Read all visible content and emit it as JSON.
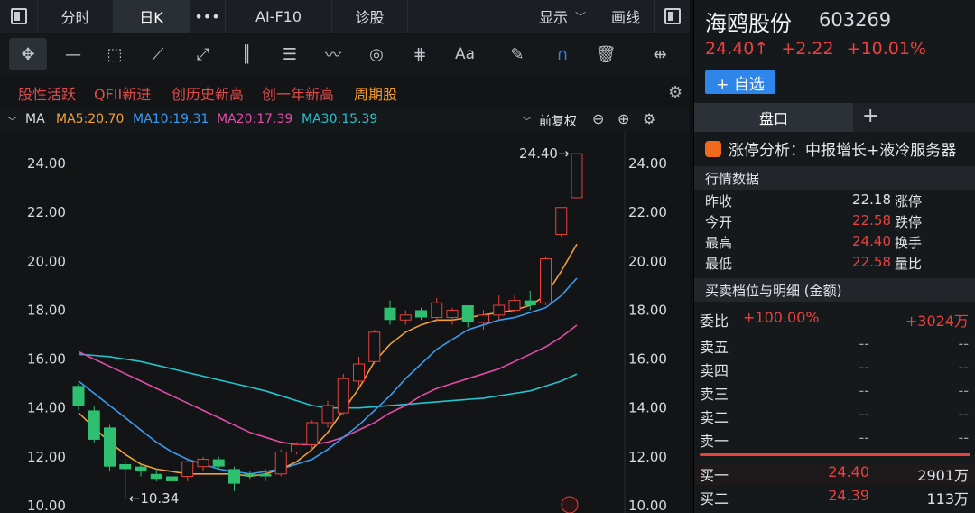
{
  "topbar": {
    "tabs": [
      "分时",
      "日K",
      "•••",
      "AI-F10",
      "诊股",
      "显示",
      "画线"
    ]
  },
  "tags": [
    "股性活跃",
    "QFII新进",
    "创历史新高",
    "创一年新高",
    "周期股"
  ],
  "ma_row": {
    "label": "MA",
    "ma5": "MA5:20.70",
    "ma10": "MA10:19.31",
    "ma20": "MA20:17.39",
    "ma30": "MA30:15.39",
    "adj": "前复权"
  },
  "stock": {
    "name": "海鸥股份",
    "code": "603269",
    "price": "24.40↑",
    "change": "+2.22",
    "pct": "+10.01%",
    "add_label": "+ 自选",
    "panel_tab": "盘口",
    "analysis": "涨停分析：中报增长+液冷服务器"
  },
  "quote": {
    "section_title": "行情数据",
    "rows": [
      {
        "label": "昨收",
        "value": "22.18",
        "label2": "涨停"
      },
      {
        "label": "今开",
        "value": "22.58",
        "label2": "跌停"
      },
      {
        "label": "最高",
        "value": "24.40",
        "label2": "换手"
      },
      {
        "label": "最低",
        "value": "22.58",
        "label2": "量比"
      }
    ]
  },
  "orderbook": {
    "section_title": "买卖档位与明细 (金额)",
    "ratio_label": "委比",
    "ratio_value": "+100.00%",
    "ratio_amount": "+3024万",
    "asks": [
      {
        "name": "卖五",
        "price": "--",
        "vol": "--"
      },
      {
        "name": "卖四",
        "price": "--",
        "vol": "--"
      },
      {
        "name": "卖三",
        "price": "--",
        "vol": "--"
      },
      {
        "name": "卖二",
        "price": "--",
        "vol": "--"
      },
      {
        "name": "卖一",
        "price": "--",
        "vol": "--"
      }
    ],
    "bids": [
      {
        "name": "买一",
        "price": "24.40",
        "vol": "2901万"
      },
      {
        "name": "买二",
        "price": "24.39",
        "vol": "113万"
      }
    ]
  },
  "chart_data": {
    "type": "candlestick",
    "y_ticks": [
      "24.00",
      "22.00",
      "20.00",
      "18.00",
      "16.00",
      "14.00",
      "12.00",
      "10.00"
    ],
    "ylim": [
      10,
      24.8
    ],
    "high_label": "24.40→",
    "low_label": "←10.34",
    "candles": [
      {
        "o": 14.9,
        "h": 15.0,
        "l": 13.9,
        "c": 14.1
      },
      {
        "o": 13.9,
        "h": 14.1,
        "l": 12.6,
        "c": 12.7
      },
      {
        "o": 13.2,
        "h": 13.3,
        "l": 11.4,
        "c": 11.6
      },
      {
        "o": 11.7,
        "h": 11.9,
        "l": 10.34,
        "c": 11.5
      },
      {
        "o": 11.6,
        "h": 11.7,
        "l": 11.2,
        "c": 11.4
      },
      {
        "o": 11.3,
        "h": 11.5,
        "l": 11.0,
        "c": 11.1
      },
      {
        "o": 11.2,
        "h": 11.4,
        "l": 10.9,
        "c": 11.0
      },
      {
        "o": 11.2,
        "h": 11.9,
        "l": 11.0,
        "c": 11.8
      },
      {
        "o": 11.6,
        "h": 12.0,
        "l": 11.4,
        "c": 11.9
      },
      {
        "o": 11.9,
        "h": 12.0,
        "l": 11.5,
        "c": 11.6
      },
      {
        "o": 11.5,
        "h": 11.6,
        "l": 10.6,
        "c": 10.9
      },
      {
        "o": 11.3,
        "h": 11.4,
        "l": 11.1,
        "c": 11.2
      },
      {
        "o": 11.3,
        "h": 11.5,
        "l": 11.0,
        "c": 11.2
      },
      {
        "o": 11.3,
        "h": 12.3,
        "l": 11.2,
        "c": 12.2
      },
      {
        "o": 12.2,
        "h": 12.6,
        "l": 12.1,
        "c": 12.5
      },
      {
        "o": 12.5,
        "h": 13.5,
        "l": 12.3,
        "c": 13.4
      },
      {
        "o": 13.4,
        "h": 14.3,
        "l": 13.2,
        "c": 14.1
      },
      {
        "o": 13.8,
        "h": 15.4,
        "l": 13.7,
        "c": 15.2
      },
      {
        "o": 15.1,
        "h": 16.1,
        "l": 14.9,
        "c": 15.8
      },
      {
        "o": 15.9,
        "h": 17.2,
        "l": 15.8,
        "c": 17.1
      },
      {
        "o": 18.1,
        "h": 18.4,
        "l": 17.4,
        "c": 17.6
      },
      {
        "o": 17.6,
        "h": 18.0,
        "l": 17.4,
        "c": 17.8
      },
      {
        "o": 18.0,
        "h": 18.1,
        "l": 17.6,
        "c": 17.7
      },
      {
        "o": 17.7,
        "h": 18.5,
        "l": 17.5,
        "c": 18.3
      },
      {
        "o": 17.7,
        "h": 18.1,
        "l": 17.4,
        "c": 18.0
      },
      {
        "o": 18.2,
        "h": 18.2,
        "l": 17.3,
        "c": 17.5
      },
      {
        "o": 17.5,
        "h": 18.0,
        "l": 17.2,
        "c": 17.8
      },
      {
        "o": 17.8,
        "h": 18.6,
        "l": 17.6,
        "c": 18.2
      },
      {
        "o": 18.0,
        "h": 18.6,
        "l": 17.9,
        "c": 18.4
      },
      {
        "o": 18.4,
        "h": 18.8,
        "l": 18.0,
        "c": 18.2
      },
      {
        "o": 18.3,
        "h": 20.2,
        "l": 18.2,
        "c": 20.1
      },
      {
        "o": 21.1,
        "h": 22.2,
        "l": 21.0,
        "c": 22.2
      },
      {
        "o": 22.6,
        "h": 24.4,
        "l": 22.58,
        "c": 24.4
      }
    ],
    "ma5": [
      13.8,
      13.2,
      12.6,
      12.1,
      11.7,
      11.5,
      11.4,
      11.3,
      11.3,
      11.3,
      11.3,
      11.2,
      11.3,
      11.5,
      11.8,
      12.3,
      13.0,
      13.9,
      14.8,
      15.9,
      16.6,
      17.1,
      17.4,
      17.6,
      17.6,
      17.7,
      17.8,
      17.9,
      18.0,
      18.2,
      18.6,
      19.6,
      20.7
    ],
    "ma10": [
      15.1,
      14.6,
      14.1,
      13.6,
      13.1,
      12.6,
      12.2,
      11.9,
      11.7,
      11.5,
      11.4,
      11.3,
      11.4,
      11.5,
      11.7,
      11.9,
      12.3,
      12.8,
      13.3,
      13.9,
      14.5,
      15.2,
      15.8,
      16.4,
      16.8,
      17.2,
      17.4,
      17.6,
      17.7,
      17.9,
      18.1,
      18.6,
      19.31
    ],
    "ma20": [
      16.3,
      16.0,
      15.7,
      15.4,
      15.1,
      14.8,
      14.5,
      14.2,
      13.9,
      13.6,
      13.3,
      13.0,
      12.8,
      12.6,
      12.5,
      12.5,
      12.6,
      12.8,
      13.1,
      13.4,
      13.8,
      14.1,
      14.5,
      14.8,
      15.0,
      15.2,
      15.4,
      15.6,
      15.9,
      16.2,
      16.5,
      16.9,
      17.39
    ],
    "ma30": [
      16.2,
      16.15,
      16.1,
      16.0,
      15.9,
      15.75,
      15.6,
      15.45,
      15.3,
      15.15,
      15.0,
      14.85,
      14.7,
      14.5,
      14.3,
      14.1,
      14.0,
      14.0,
      14.0,
      14.05,
      14.1,
      14.15,
      14.2,
      14.25,
      14.3,
      14.35,
      14.4,
      14.5,
      14.6,
      14.7,
      14.9,
      15.1,
      15.39
    ],
    "colors": {
      "up": "#e8413f",
      "down": "#2fbf71",
      "ma5": "#f0a03a",
      "ma10": "#3a9bf0",
      "ma20": "#e04ca8",
      "ma30": "#22c4d0"
    }
  }
}
